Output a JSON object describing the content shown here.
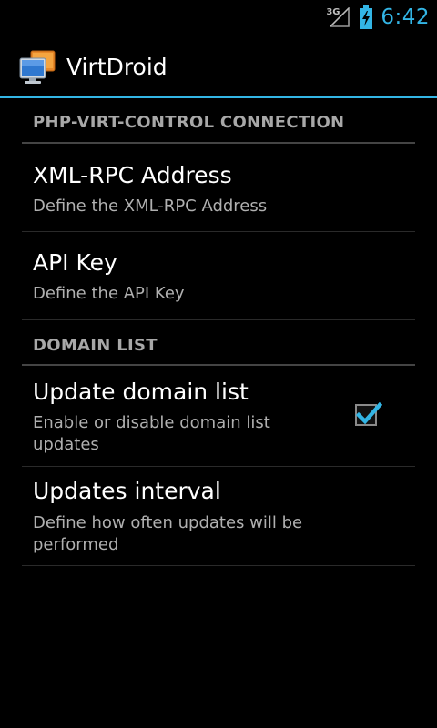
{
  "status_bar": {
    "network_type": "3G",
    "time": "6:42",
    "accent_color": "#33b5e5"
  },
  "action_bar": {
    "app_name": "VirtDroid",
    "icon": "virtdroid-app-icon"
  },
  "sections": [
    {
      "header": "PHP-VIRT-CONTROL CONNECTION",
      "items": [
        {
          "title": "XML-RPC Address",
          "summary": "Define the XML-RPC Address"
        },
        {
          "title": "API Key",
          "summary": "Define the API Key"
        }
      ]
    },
    {
      "header": "DOMAIN LIST",
      "items": [
        {
          "title": "Update domain list",
          "summary": "Enable or disable domain list updates",
          "checked": true
        },
        {
          "title": "Updates interval",
          "summary": "Define how often updates will be performed"
        }
      ]
    }
  ]
}
